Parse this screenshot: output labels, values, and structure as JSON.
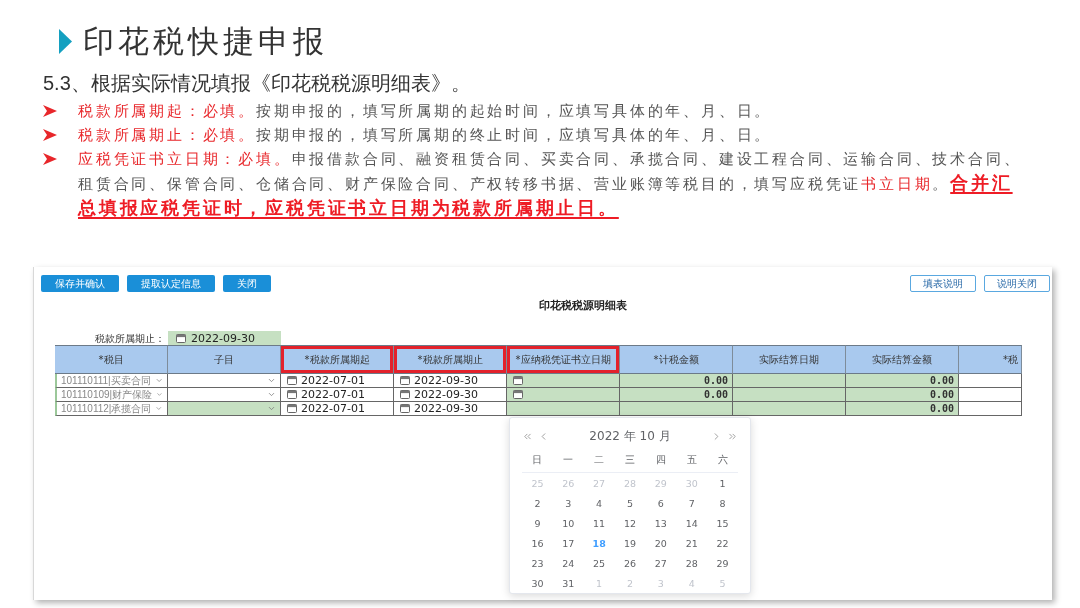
{
  "slide": {
    "title": "印花税快捷申报"
  },
  "heading": "5.3、根据实际情况填报《印花税税源明细表》。",
  "bullets": [
    {
      "segments": [
        {
          "kind": "label",
          "text": "税款所属期起：必填。"
        },
        {
          "kind": "plain",
          "text": "按期申报的，填写所属期的起始时间，应填写具体的年、月、日。"
        }
      ]
    },
    {
      "segments": [
        {
          "kind": "label",
          "text": "税款所属期止：必填。"
        },
        {
          "kind": "plain",
          "text": "按期申报的，填写所属期的终止时间，应填写具体的年、月、日。"
        }
      ]
    },
    {
      "segments": [
        {
          "kind": "label",
          "text": "应税凭证书立日期：必填。"
        },
        {
          "kind": "plain",
          "text": "申报借款合同、融资租赁合同、买卖合同、承揽合同、建设工程合同、运输合同、技术合同、租赁合同、保管合同、仓储合同、财产保险合同、产权转移书据、营业账簿等税目的，填写应税凭证"
        },
        {
          "kind": "label",
          "text": "书立日期"
        },
        {
          "kind": "plain",
          "text": "。"
        },
        {
          "kind": "emphasis",
          "text": "合并汇总填报应税凭证时，应税凭证书立日期为税款所属期止日。"
        }
      ]
    }
  ],
  "screenshot": {
    "toolbar": [
      "保存并确认",
      "提取认定信息",
      "关闭"
    ],
    "help_buttons": [
      "填表说明",
      "说明关闭"
    ],
    "form_title": "印花税税源明细表",
    "period_end": {
      "label": "税款所属期止：",
      "value": "2022-09-30"
    },
    "table": {
      "columns": [
        {
          "label": "*税目",
          "highlighted": false
        },
        {
          "label": "子目",
          "highlighted": false
        },
        {
          "label": "*税款所属期起",
          "highlighted": true
        },
        {
          "label": "*税款所属期止",
          "highlighted": true
        },
        {
          "label": "*应纳税凭证书立日期",
          "highlighted": true
        },
        {
          "label": "*计税金额",
          "highlighted": false
        },
        {
          "label": "实际结算日期",
          "highlighted": false
        },
        {
          "label": "实际结算金额",
          "highlighted": false
        },
        {
          "label": "*税",
          "highlighted": false
        }
      ],
      "rows": [
        {
          "cells": [
            {
              "kind": "select",
              "text": "101110111|买卖合同",
              "shaded": false
            },
            {
              "kind": "select",
              "shaded": false
            },
            {
              "kind": "date",
              "text": "2022-07-01",
              "shaded": false
            },
            {
              "kind": "date",
              "text": "2022-09-30",
              "shaded": false
            },
            {
              "kind": "date",
              "shaded": true
            },
            {
              "kind": "amount",
              "text": "0.00",
              "shaded": true
            },
            {
              "kind": "blank",
              "shaded": true
            },
            {
              "kind": "amount",
              "text": "0.00",
              "shaded": true
            },
            {
              "kind": "blank",
              "shaded": false
            }
          ]
        },
        {
          "cells": [
            {
              "kind": "select",
              "text": "101110109|财产保险",
              "shaded": false
            },
            {
              "kind": "select",
              "shaded": false
            },
            {
              "kind": "date",
              "text": "2022-07-01",
              "shaded": false
            },
            {
              "kind": "date",
              "text": "2022-09-30",
              "shaded": false
            },
            {
              "kind": "date",
              "shaded": true
            },
            {
              "kind": "amount",
              "text": "0.00",
              "shaded": true
            },
            {
              "kind": "blank",
              "shaded": true
            },
            {
              "kind": "amount",
              "text": "0.00",
              "shaded": true
            },
            {
              "kind": "blank",
              "shaded": false
            }
          ]
        },
        {
          "cells": [
            {
              "kind": "select",
              "text": "101110112|承揽合同",
              "shaded": false
            },
            {
              "kind": "select",
              "shaded": true
            },
            {
              "kind": "date",
              "text": "2022-07-01",
              "shaded": false
            },
            {
              "kind": "date",
              "text": "2022-09-30",
              "shaded": false
            },
            {
              "kind": "blank",
              "shaded": true
            },
            {
              "kind": "blank",
              "shaded": true
            },
            {
              "kind": "blank",
              "shaded": true
            },
            {
              "kind": "amount",
              "text": "0.00",
              "shaded": true
            },
            {
              "kind": "blank",
              "shaded": false
            }
          ]
        }
      ]
    },
    "date_picker": {
      "year_month": "2022 年 10 月",
      "weekdays": [
        "日",
        "一",
        "二",
        "三",
        "四",
        "五",
        "六"
      ],
      "days": [
        {
          "day": "25",
          "in_month": false,
          "today": false
        },
        {
          "day": "26",
          "in_month": false,
          "today": false
        },
        {
          "day": "27",
          "in_month": false,
          "today": false
        },
        {
          "day": "28",
          "in_month": false,
          "today": false
        },
        {
          "day": "29",
          "in_month": false,
          "today": false
        },
        {
          "day": "30",
          "in_month": false,
          "today": false
        },
        {
          "day": "1",
          "in_month": true,
          "today": false
        },
        {
          "day": "2",
          "in_month": true,
          "today": false
        },
        {
          "day": "3",
          "in_month": true,
          "today": false
        },
        {
          "day": "4",
          "in_month": true,
          "today": false
        },
        {
          "day": "5",
          "in_month": true,
          "today": false
        },
        {
          "day": "6",
          "in_month": true,
          "today": false
        },
        {
          "day": "7",
          "in_month": true,
          "today": false
        },
        {
          "day": "8",
          "in_month": true,
          "today": false
        },
        {
          "day": "9",
          "in_month": true,
          "today": false
        },
        {
          "day": "10",
          "in_month": true,
          "today": false
        },
        {
          "day": "11",
          "in_month": true,
          "today": false
        },
        {
          "day": "12",
          "in_month": true,
          "today": false
        },
        {
          "day": "13",
          "in_month": true,
          "today": false
        },
        {
          "day": "14",
          "in_month": true,
          "today": false
        },
        {
          "day": "15",
          "in_month": true,
          "today": false
        },
        {
          "day": "16",
          "in_month": true,
          "today": false
        },
        {
          "day": "17",
          "in_month": true,
          "today": false
        },
        {
          "day": "18",
          "in_month": true,
          "today": true
        },
        {
          "day": "19",
          "in_month": true,
          "today": false
        },
        {
          "day": "20",
          "in_month": true,
          "today": false
        },
        {
          "day": "21",
          "in_month": true,
          "today": false
        },
        {
          "day": "22",
          "in_month": true,
          "today": false
        },
        {
          "day": "23",
          "in_month": true,
          "today": false
        },
        {
          "day": "24",
          "in_month": true,
          "today": false
        },
        {
          "day": "25",
          "in_month": true,
          "today": false
        },
        {
          "day": "26",
          "in_month": true,
          "today": false
        },
        {
          "day": "27",
          "in_month": true,
          "today": false
        },
        {
          "day": "28",
          "in_month": true,
          "today": false
        },
        {
          "day": "29",
          "in_month": true,
          "today": false
        },
        {
          "day": "30",
          "in_month": true,
          "today": false
        },
        {
          "day": "31",
          "in_month": true,
          "today": false
        },
        {
          "day": "1",
          "in_month": false,
          "today": false
        },
        {
          "day": "2",
          "in_month": false,
          "today": false
        },
        {
          "day": "3",
          "in_month": false,
          "today": false
        },
        {
          "day": "4",
          "in_month": false,
          "today": false
        },
        {
          "day": "5",
          "in_month": false,
          "today": false
        }
      ]
    }
  }
}
